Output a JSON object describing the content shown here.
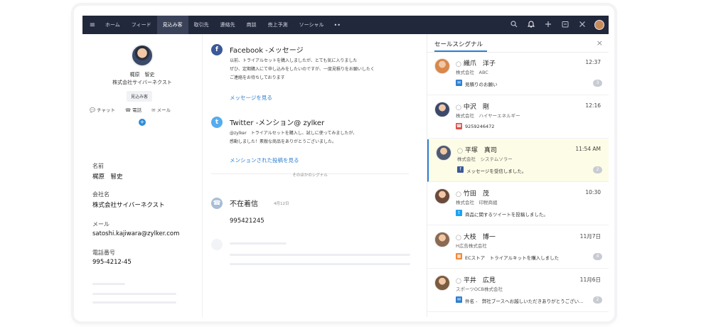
{
  "nav": {
    "tabs": [
      "ホーム",
      "フィード",
      "見込み客",
      "取引先",
      "連絡先",
      "商談",
      "売上予測",
      "ソーシャル"
    ],
    "active_tab": "見込み客",
    "more": "••"
  },
  "lead": {
    "name": "梶原　智史",
    "company": "株式会社サイバーネクスト",
    "status": "見込み客",
    "actions": {
      "chat": "チャット",
      "call": "電話",
      "mail": "メール"
    },
    "fields": {
      "name_label": "名前",
      "name_value": "梶原　智史",
      "company_label": "会社名",
      "company_value": "株式会社サイバーネクスト",
      "email_label": "メール",
      "email_value": "satoshi.kajiwara@zylker.com",
      "phone_label": "電話番号",
      "phone_value": "995-4212-45"
    }
  },
  "feed": {
    "facebook": {
      "title": "Facebook -メッセージ",
      "line1": "以前、トライアルセットを購入しましたが、とても気に入りました",
      "line2": "ぜひ、定期購入にて申し込みをしたいのですが、一度見積りをお願いしたく",
      "line3": "ご連絡をお待ちしております",
      "link": "メッセージを見る"
    },
    "twitter": {
      "title": "Twitter -メンション@ zylker",
      "line1": "@zylker　トライアルセットを購入し、試しに使ってみましたが、",
      "line2": "感動しました！素敵な商品をありがとうございました。",
      "link": "メンションされた投稿を見る"
    },
    "divider": "そのほかのシグナル",
    "missed": {
      "title": "不在着信",
      "date": "4月12日",
      "number": "995421245"
    }
  },
  "signals": {
    "title": "セールスシグナル",
    "close": "×",
    "items": [
      {
        "person": "織爪　洋子",
        "company": "株式会社　ABC",
        "time": "12:37",
        "message": "見積りのお願い",
        "badge": "3",
        "icon": "mail-icon",
        "icon_color": "#2e7fd1",
        "avatar_color": "#d9874a"
      },
      {
        "person": "中沢　剛",
        "company": "株式会社　ハイヤーエネルギー",
        "time": "12:16",
        "message": "9259246472",
        "badge": "",
        "icon": "phone-icon",
        "icon_color": "#d9534f",
        "avatar_color": "#3b4a6b"
      },
      {
        "person": "平塚　真司",
        "company": "株式会社　システムソラー",
        "time": "11:54 AM",
        "message": "メッセージを受信しました。",
        "badge": "2",
        "icon": "facebook-icon",
        "icon_color": "#3b5998",
        "avatar_color": "#4d5a70"
      },
      {
        "person": "竹田　茂",
        "company": "株式会社　印税商組",
        "time": "10:30",
        "message": "商品に関するツイートを投稿しました。",
        "badge": "",
        "icon": "twitter-icon",
        "icon_color": "#1da1f2",
        "avatar_color": "#6b4a3a"
      },
      {
        "person": "大枝　博一",
        "company": "H広告株式会社",
        "time": "11月7日",
        "message": "ECストア　トライアルキットを購入しました",
        "badge": "4",
        "icon": "store-icon",
        "icon_color": "#f08a3c",
        "avatar_color": "#8a6a52"
      },
      {
        "person": "平井　広見",
        "company": "スポーツOCB株式会社",
        "time": "11月6日",
        "message": "件名 -　弊社ブースへお越しいただきありがとうござい…",
        "badge": "2",
        "icon": "mail-icon",
        "icon_color": "#2e7fd1",
        "avatar_color": "#7a5c40"
      }
    ]
  }
}
